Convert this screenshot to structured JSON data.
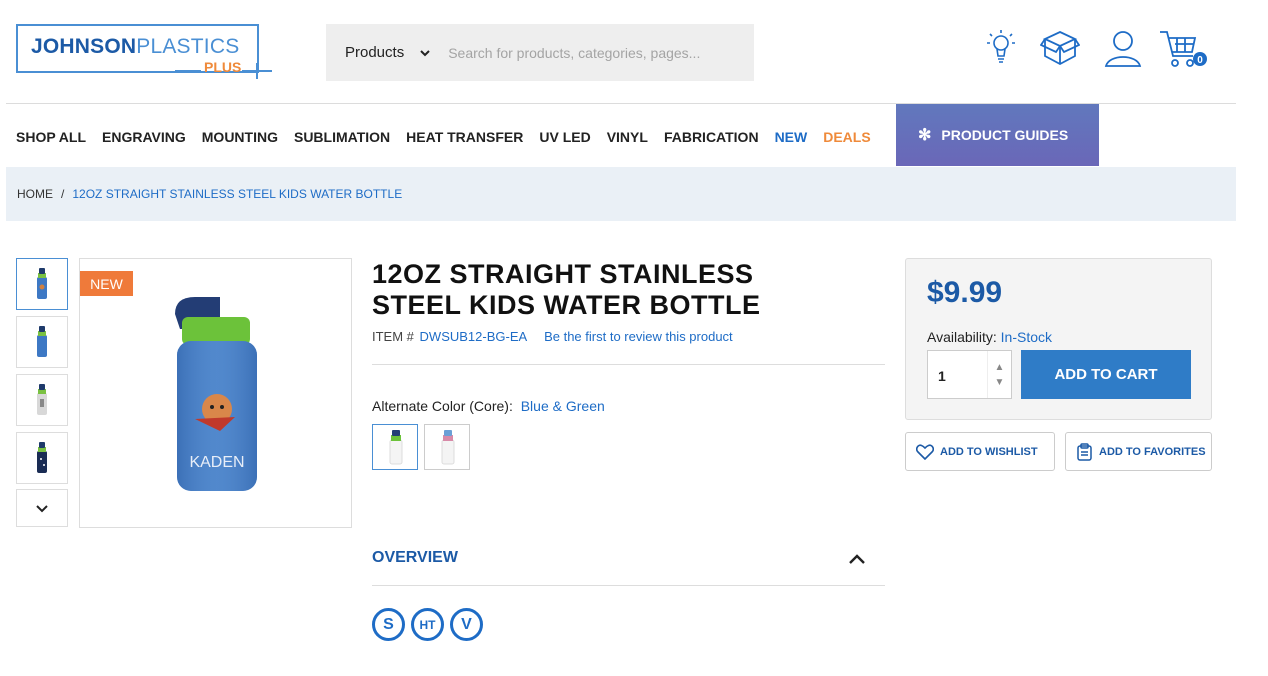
{
  "header": {
    "logo": {
      "word1": "JOHNSON",
      "word2": "PLASTICS",
      "sub": "PLUS"
    },
    "search": {
      "category": "Products",
      "placeholder": "Search for products, categories, pages..."
    },
    "cart_count": "0"
  },
  "nav": {
    "items": [
      "SHOP ALL",
      "ENGRAVING",
      "MOUNTING",
      "SUBLIMATION",
      "HEAT TRANSFER",
      "UV LED",
      "VINYL",
      "FABRICATION",
      "NEW",
      "DEALS"
    ],
    "guides": "PRODUCT GUIDES"
  },
  "breadcrumb": {
    "home": "HOME",
    "separator": "/",
    "current": "12OZ STRAIGHT STAINLESS STEEL KIDS WATER BOTTLE"
  },
  "gallery": {
    "badge": "NEW"
  },
  "product": {
    "title": "12OZ STRAIGHT STAINLESS STEEL KIDS WATER BOTTLE",
    "item_label": "ITEM #",
    "sku": "DWSUB12-BG-EA",
    "review_link": "Be the first to review this product",
    "alt_color_label": "Alternate Color (Core):",
    "alt_color_value": "Blue & Green",
    "overview_label": "OVERVIEW",
    "badges": [
      "S",
      "HT",
      "V"
    ],
    "bottle_name": "KADEN"
  },
  "purchase": {
    "price": "$9.99",
    "availability_label": "Availability:",
    "availability_value": "In-Stock",
    "quantity": "1",
    "add_to_cart": "ADD TO CART",
    "wishlist": "ADD TO WISHLIST",
    "favorites": "ADD TO FAVORITES"
  },
  "colors": {
    "brand_blue": "#1c5aa6",
    "accent_orange": "#ef8a3a",
    "cart_button": "#2f7cc7"
  }
}
